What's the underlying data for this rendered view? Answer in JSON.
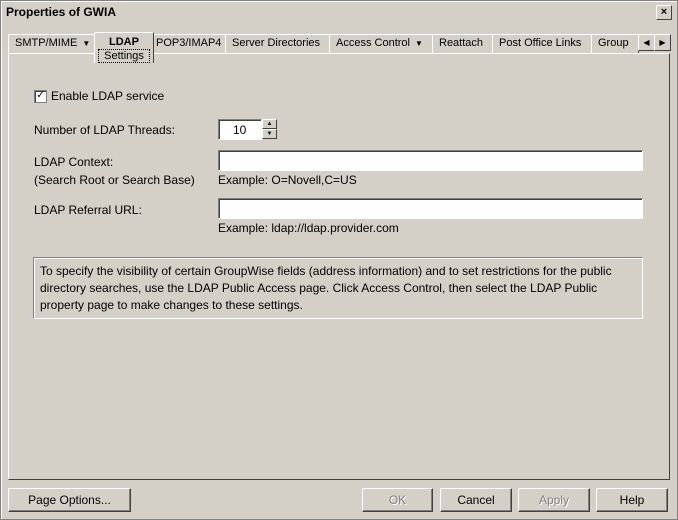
{
  "window": {
    "title": "Properties of GWIA",
    "close_glyph": "×"
  },
  "tabs": [
    {
      "label": "SMTP/MIME",
      "has_dropdown": true
    },
    {
      "label": "LDAP",
      "sub": "Settings",
      "active": true
    },
    {
      "label": "POP3/IMAP4"
    },
    {
      "label": "Server Directories"
    },
    {
      "label": "Access Control",
      "has_dropdown": true
    },
    {
      "label": "Reattach"
    },
    {
      "label": "Post Office Links"
    },
    {
      "label": "Group"
    }
  ],
  "form": {
    "enable_ldap": {
      "label": "Enable LDAP service",
      "checked": true
    },
    "threads": {
      "label": "Number of LDAP Threads:",
      "value": "10"
    },
    "context": {
      "label": "LDAP Context:",
      "sublabel": "(Search Root or Search Base)",
      "value": "",
      "example": "Example: O=Novell,C=US"
    },
    "referral": {
      "label": "LDAP Referral URL:",
      "value": "",
      "example": "Example: ldap://ldap.provider.com"
    }
  },
  "info_text": "To specify the visibility of certain GroupWise fields (address information) and to set restrictions for the public directory searches, use the LDAP Public Access page. Click Access Control, then select the LDAP Public property page to make changes to these settings.",
  "buttons": {
    "page_options": "Page Options...",
    "ok": "OK",
    "cancel": "Cancel",
    "apply": "Apply",
    "help": "Help"
  }
}
